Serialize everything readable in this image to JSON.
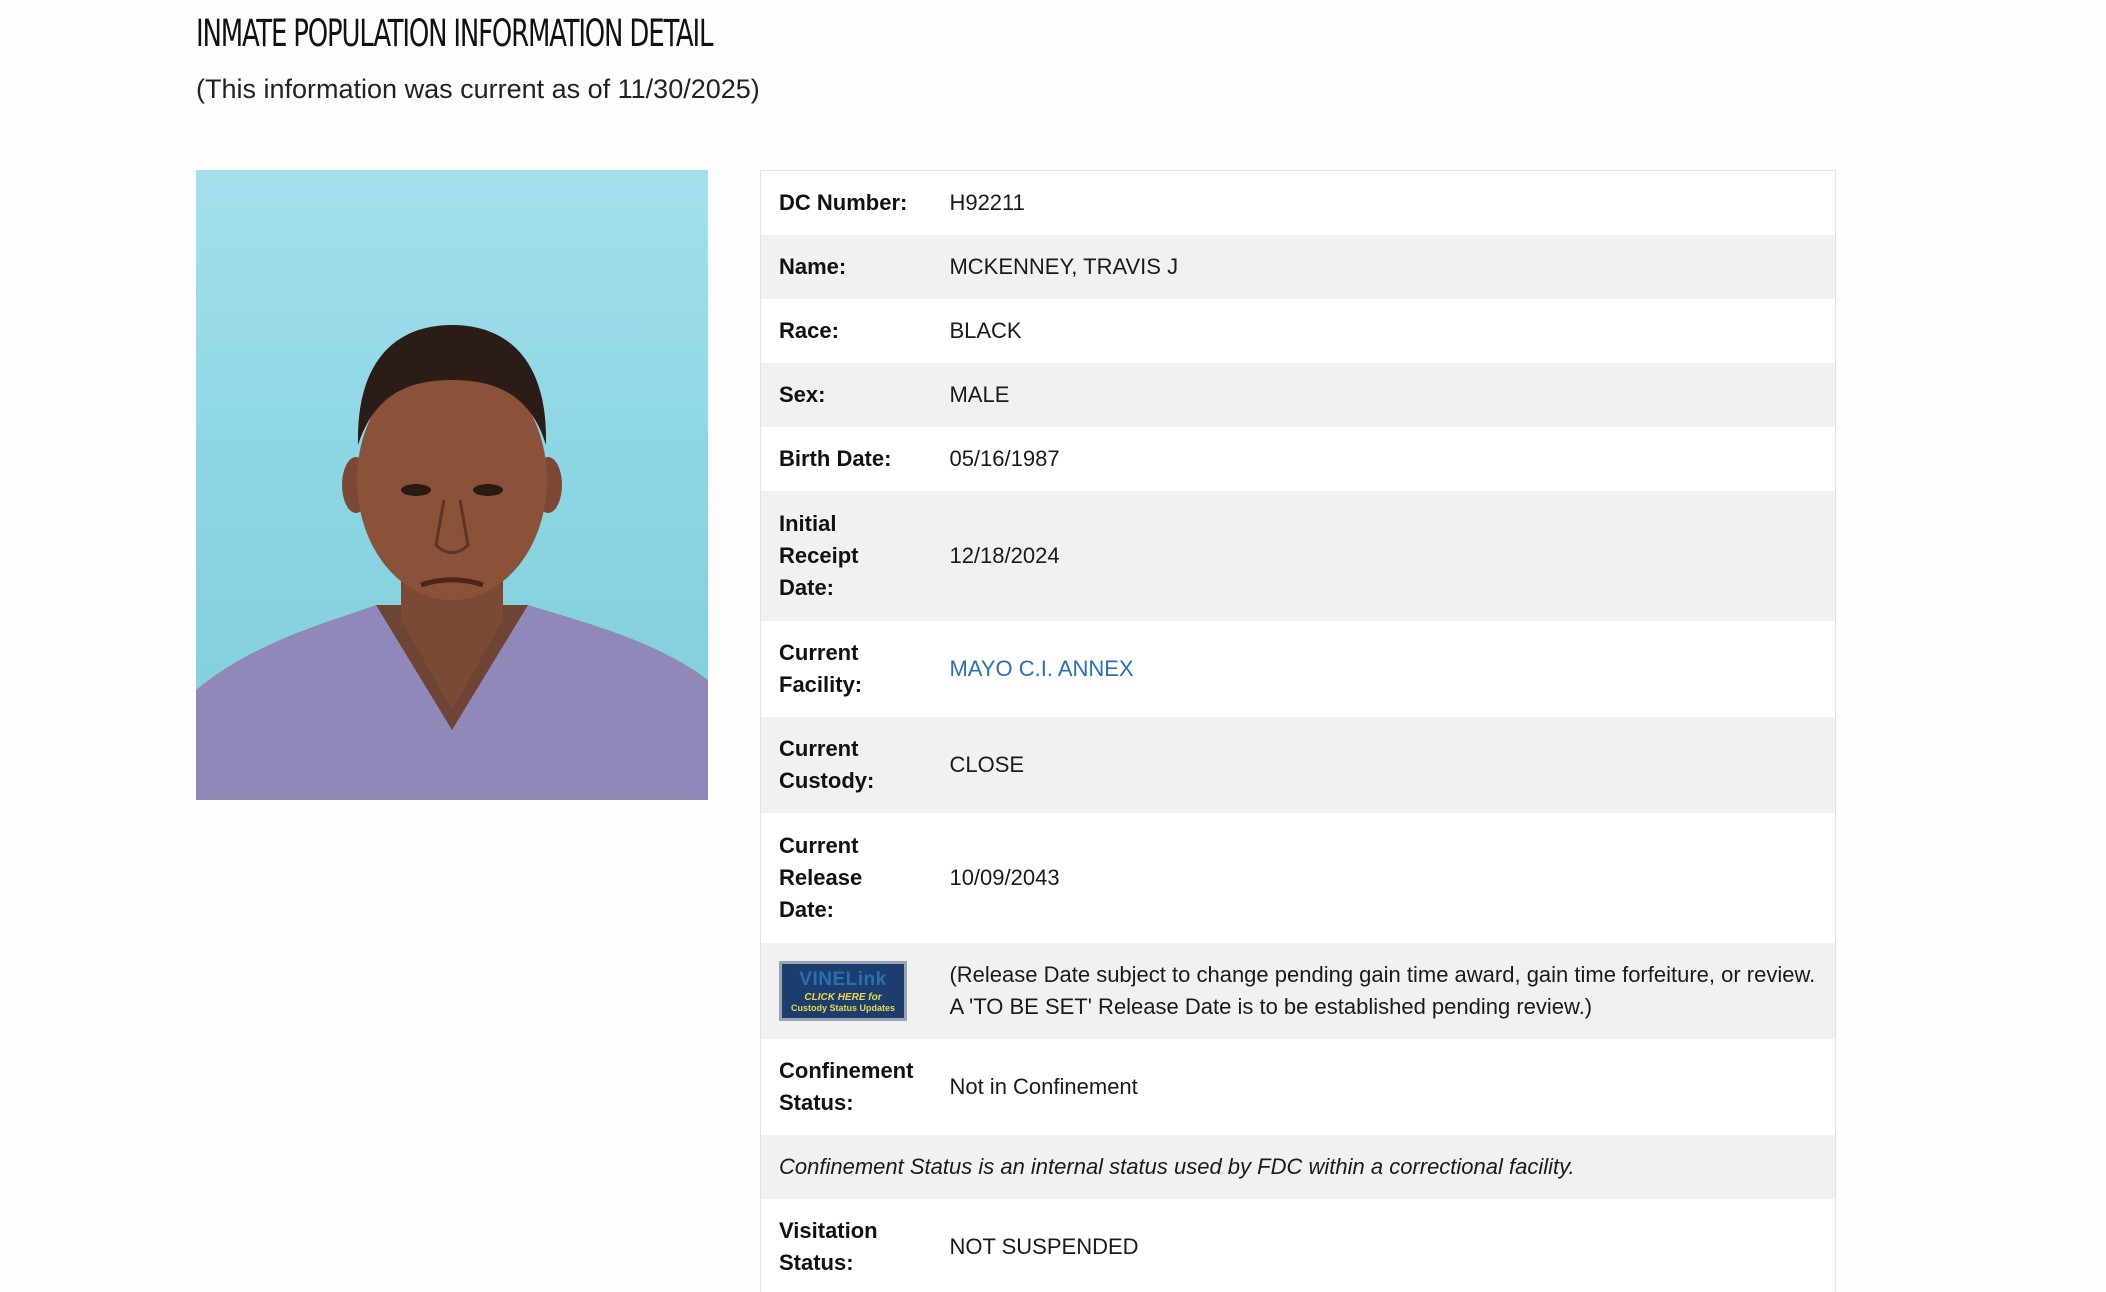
{
  "header": {
    "title": "INMATE POPULATION INFORMATION DETAIL",
    "as_of": "(This information was current as of 11/30/2025)"
  },
  "record": {
    "dc_number": {
      "label": "DC Number:",
      "value": "H92211"
    },
    "name": {
      "label": "Name:",
      "value": "MCKENNEY, TRAVIS J"
    },
    "race": {
      "label": "Race:",
      "value": "BLACK"
    },
    "sex": {
      "label": "Sex:",
      "value": "MALE"
    },
    "birth_date": {
      "label": "Birth Date:",
      "value": "05/16/1987"
    },
    "initial_receipt_date": {
      "label": "Initial Receipt Date:",
      "value": "12/18/2024"
    },
    "current_facility": {
      "label": "Current Facility:",
      "value": "MAYO C.I. ANNEX"
    },
    "current_custody": {
      "label": "Current Custody:",
      "value": "CLOSE"
    },
    "current_release_date": {
      "label": "Current Release Date:",
      "value": "10/09/2043"
    },
    "release_note": "(Release Date subject to change pending gain time award, gain time forfeiture, or review. A 'TO BE SET' Release Date is to be established pending review.)",
    "confinement_status": {
      "label": "Confinement Status:",
      "value": "Not in Confinement"
    },
    "confinement_note": "Confinement Status is an internal status used by FDC within a correctional facility.",
    "visitation_status": {
      "label": "Visitation Status:",
      "value": "NOT SUSPENDED"
    }
  },
  "vinelink": {
    "main": "VINELink",
    "click": "CLICK HERE for",
    "sub": "Custody Status Updates"
  },
  "colors": {
    "link": "#2c6fae",
    "row_alt": "#f1f1f1",
    "photo_background": "#8ed6e4",
    "vine_badge": "#1c3e6e"
  }
}
